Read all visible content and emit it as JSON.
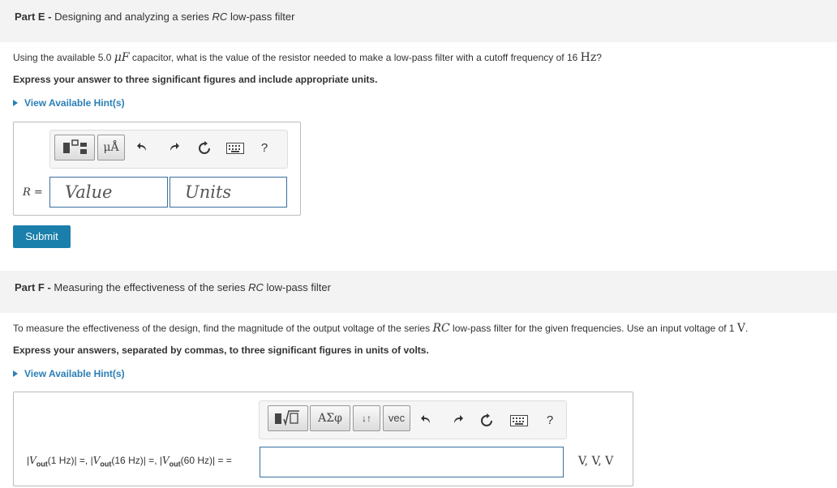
{
  "partE": {
    "label": "Part E -",
    "title_pre": "Designing and analyzing a series ",
    "title_em": "RC",
    "title_post": " low-pass filter",
    "question_pre": "Using the available 5.0 ",
    "question_math1": "μF",
    "question_mid": " capacitor, what is the value of the resistor needed to make a low-pass filter with a cutoff frequency of 16 ",
    "question_math2": "Hz",
    "question_post": "?",
    "instruction": "Express your answer to three significant figures and include appropriate units.",
    "hint": "View Available Hint(s)",
    "toolbar": {
      "units_btn": "μÅ",
      "help": "?"
    },
    "var_label": "R =",
    "value_placeholder": "Value",
    "units_placeholder": "Units",
    "submit": "Submit"
  },
  "partF": {
    "label": "Part F -",
    "title": "Measuring the effectiveness of the series ",
    "title_em": "RC",
    "title_post": " low-pass filter",
    "question_pre": "To measure the effectiveness of the design, find the magnitude of the output voltage of the series ",
    "question_math1": "RC",
    "question_mid": " low-pass filter for the given frequencies. Use an input voltage of 1 ",
    "question_math2": "V",
    "question_post": ".",
    "instruction": "Express your answers, separated by commas, to three significant figures in units of volts.",
    "hint": "View Available Hint(s)",
    "toolbar": {
      "greek": "ΑΣφ",
      "sort": "↓↑",
      "vec": "vec",
      "help": "?"
    },
    "eq_label": "|V_out(1 Hz)| =, |V_out(16 Hz)| =, |V_out(60 Hz)| = =",
    "eq_parts": [
      "|",
      "V",
      "out",
      "(1 Hz)| =, |",
      "V",
      "out",
      "(16 Hz)| =, |",
      "V",
      "out",
      "(60 Hz)| = ="
    ],
    "units": "V, V, V"
  }
}
